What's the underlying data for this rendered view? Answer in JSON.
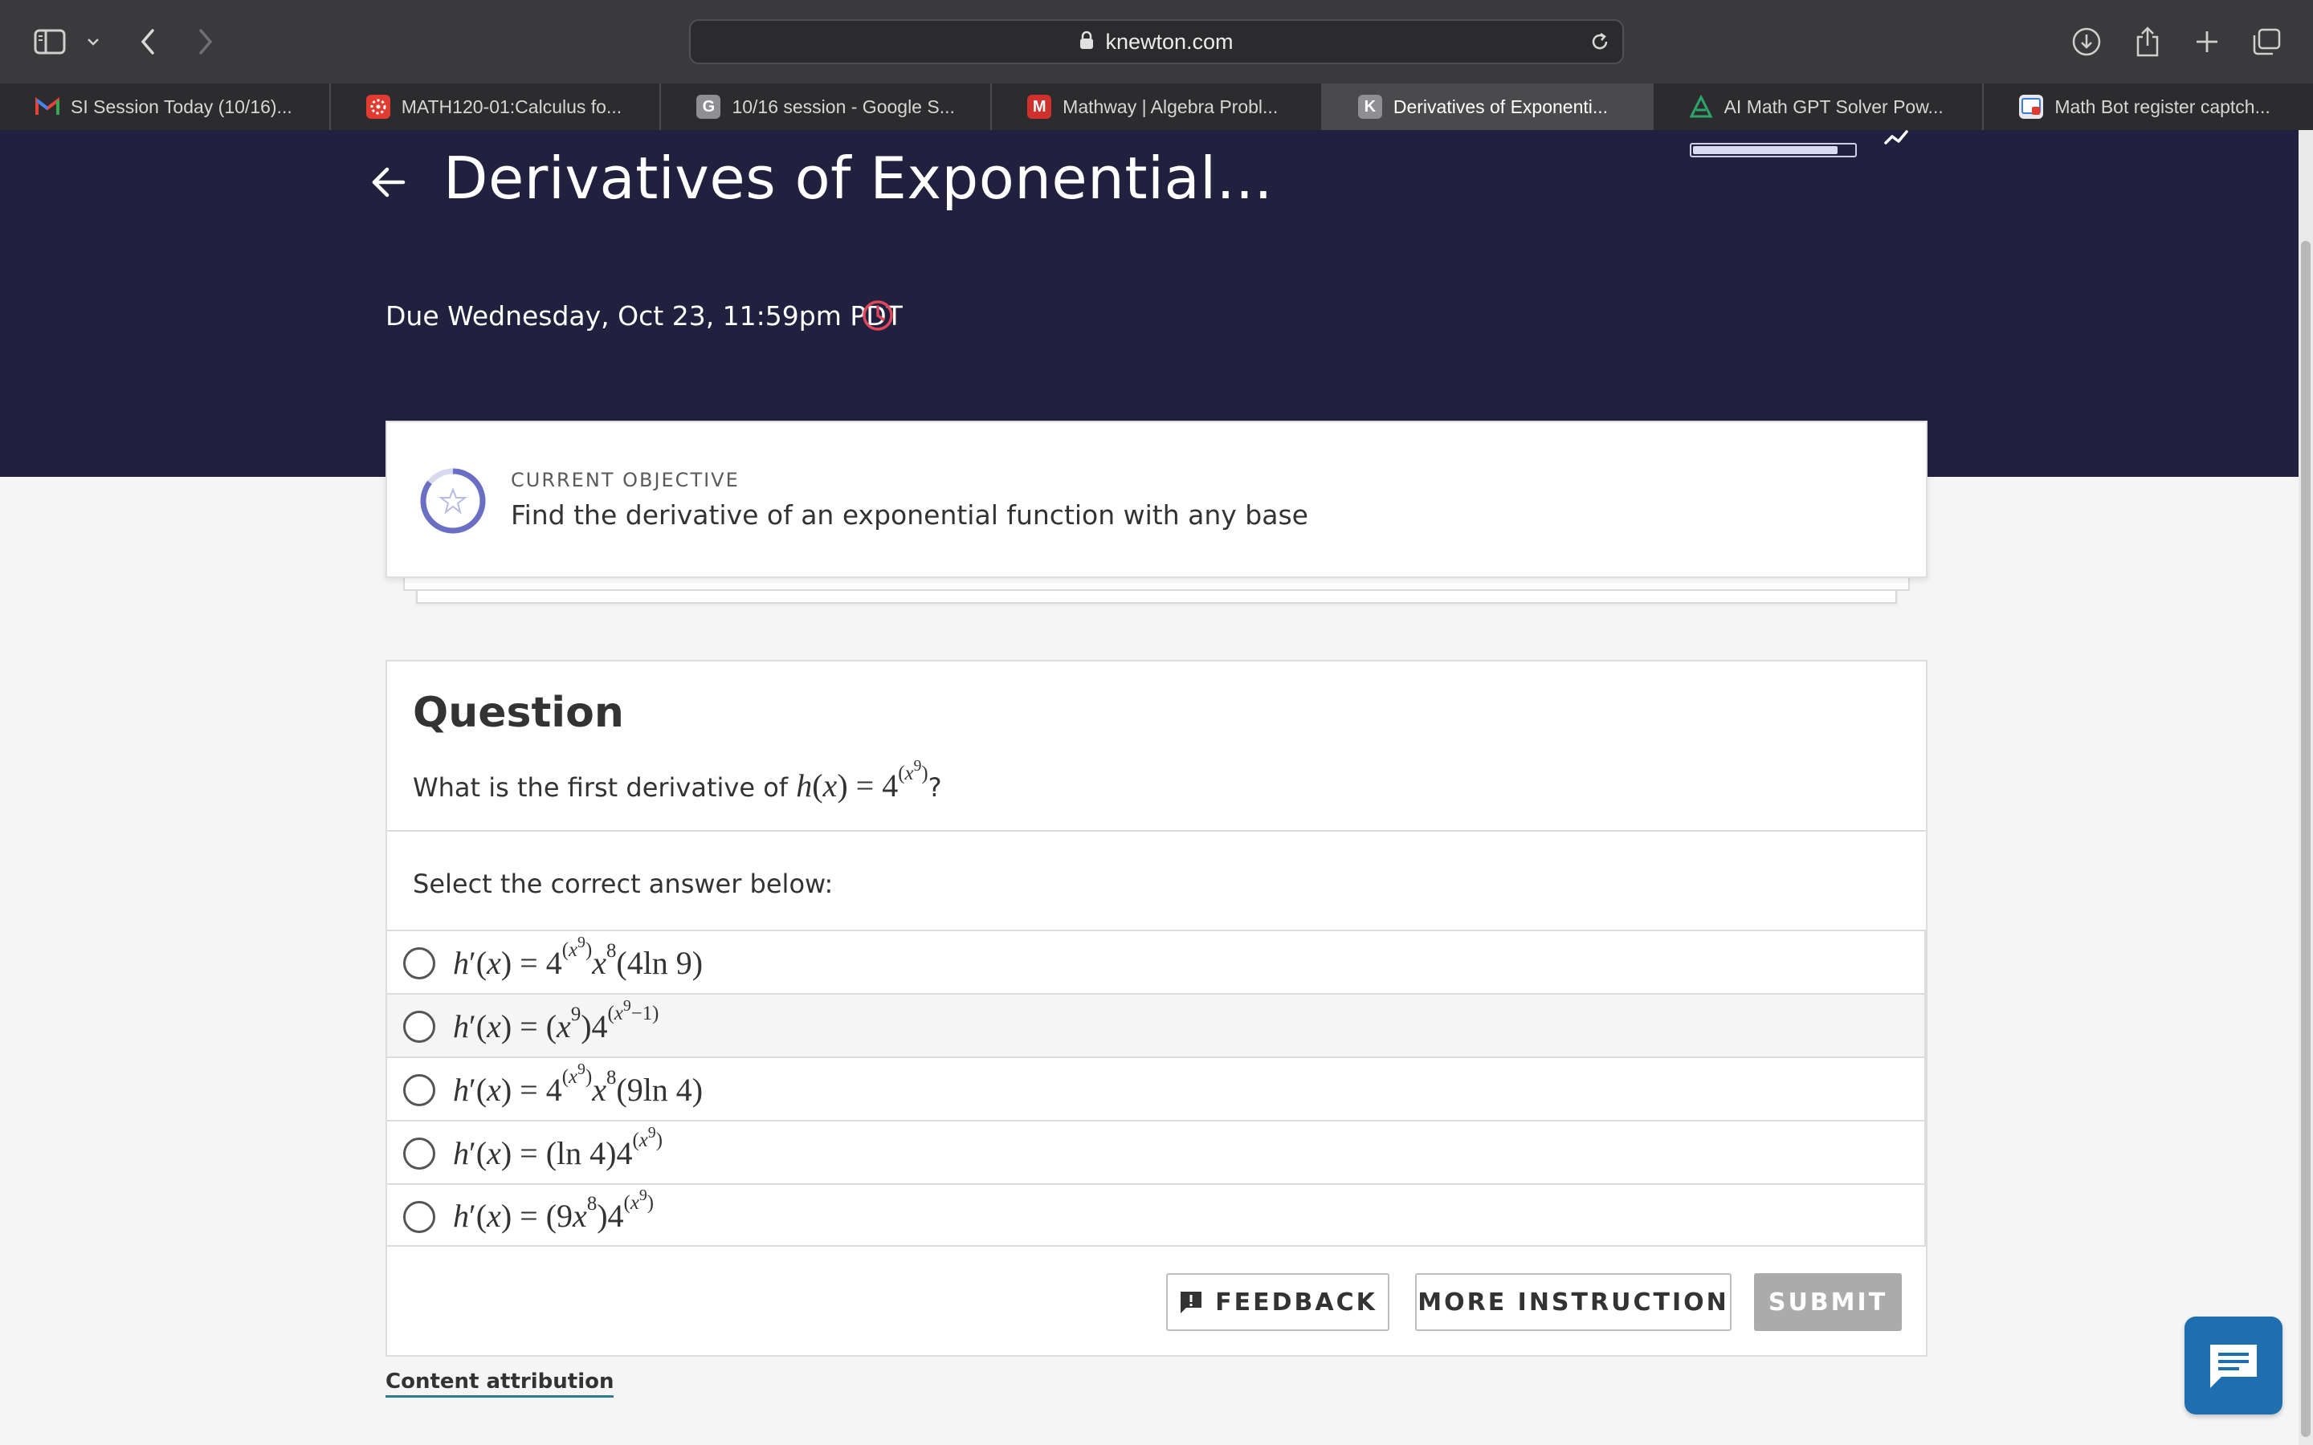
{
  "browser": {
    "url": "knewton.com",
    "tabs": [
      {
        "label": "SI Session Today (10/16)...",
        "icon": "gmail-icon",
        "color": "#ea4335"
      },
      {
        "label": "MATH120-01:Calculus fo...",
        "icon": "canvas-icon",
        "color": "#e03c31"
      },
      {
        "label": "10/16 session - Google S...",
        "icon": "google-icon",
        "glyph": "G",
        "color": "#8e8e93"
      },
      {
        "label": "Mathway | Algebra Probl...",
        "icon": "mathway-icon",
        "glyph": "M",
        "color": "#d0312d"
      },
      {
        "label": "Derivatives of Exponenti...",
        "icon": "knewton-icon",
        "glyph": "K",
        "color": "#8e8e93",
        "active": true
      },
      {
        "label": "AI Math GPT Solver Pow...",
        "icon": "mathgpt-icon",
        "color": "#2fa56b"
      },
      {
        "label": "Math Bot register captch...",
        "icon": "mathbot-icon",
        "color": "#3b7ddd"
      }
    ]
  },
  "header": {
    "title": "Derivatives of Exponential...",
    "due": "Due Wednesday, Oct 23, 11:59pm PDT",
    "progress": 0.9
  },
  "objective": {
    "caption": "CURRENT OBJECTIVE",
    "text": "Find the derivative of an exponential function with any base"
  },
  "question": {
    "heading": "Question",
    "prompt": "What is the first derivative of",
    "suffix": "?",
    "select_label": "Select the correct answer below:"
  },
  "buttons": {
    "feedback": "FEEDBACK",
    "more": "MORE INSTRUCTION",
    "submit": "SUBMIT"
  },
  "attribution": "Content attribution",
  "colors": {
    "hero": "#21203f",
    "accent": "#6a6fc4",
    "clock": "#e0465a",
    "chat": "#1f6fb0"
  }
}
